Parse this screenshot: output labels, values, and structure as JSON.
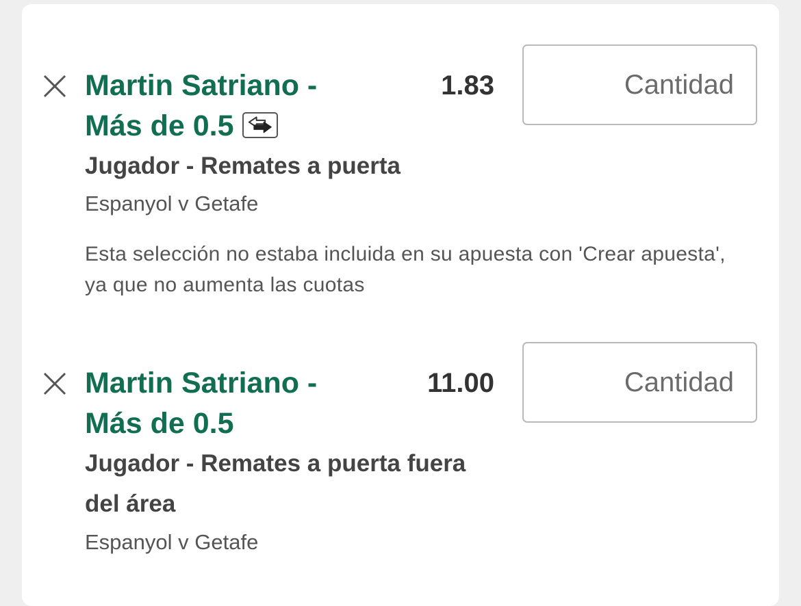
{
  "bets": [
    {
      "title": "Martin Satriano - Más de 0.5",
      "odds": "1.83",
      "stake_placeholder": "Cantidad",
      "market": "Jugador - Remates a puerta",
      "event": "Espanyol v Getafe",
      "notice": "Esta selección no estaba incluida en su apuesta con 'Crear apuesta', ya que no aumenta las cuotas",
      "icon": "swap-arrows-icon"
    },
    {
      "title": "Martin Satriano - Más de 0.5",
      "odds": "11.00",
      "stake_placeholder": "Cantidad",
      "market": "Jugador - Remates a puerta fuera del área",
      "event": "Espanyol v Getafe"
    }
  ],
  "colors": {
    "selection_green": "#126e51",
    "text_dark": "#333333",
    "text_muted": "#555555",
    "input_border": "#b9b9b9",
    "background": "#efefef"
  }
}
